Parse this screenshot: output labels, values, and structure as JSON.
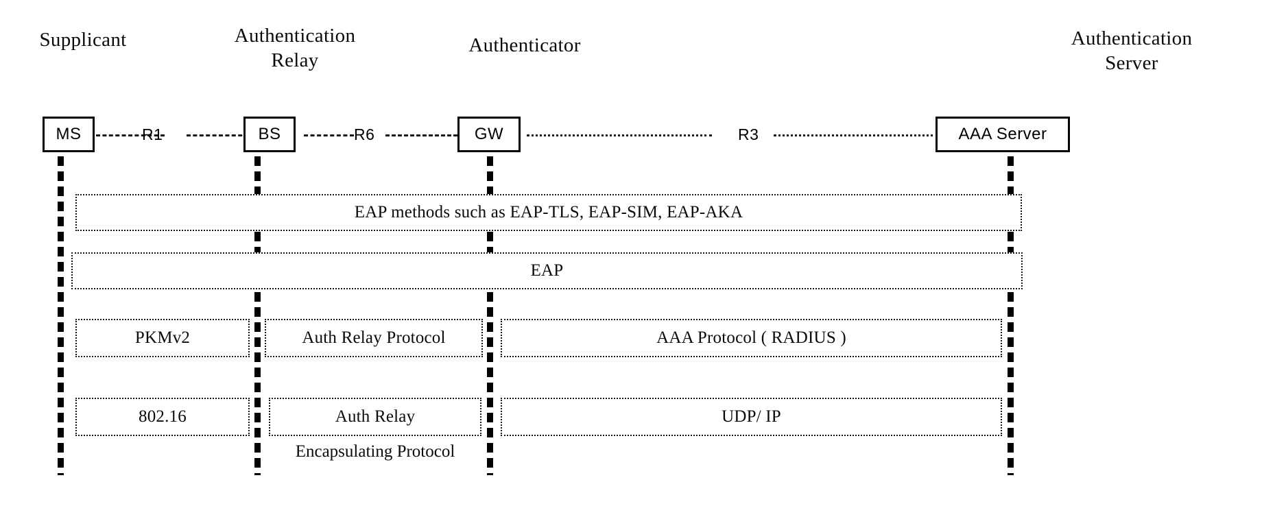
{
  "diagram": {
    "roles": [
      {
        "id": "supplicant",
        "label": "Supplicant"
      },
      {
        "id": "auth-relay",
        "label": "Authentication\nRelay"
      },
      {
        "id": "authenticator",
        "label": "Authenticator"
      },
      {
        "id": "auth-server",
        "label": "Authentication\nServer"
      }
    ],
    "nodes": [
      {
        "id": "ms",
        "label": "MS"
      },
      {
        "id": "bs",
        "label": "BS"
      },
      {
        "id": "gw",
        "label": "GW"
      },
      {
        "id": "aaa-server",
        "label": "AAA Server"
      }
    ],
    "reference_points": [
      {
        "id": "r1",
        "label": "R1"
      },
      {
        "id": "r6",
        "label": "R6"
      },
      {
        "id": "r3",
        "label": "R3"
      }
    ],
    "layers": [
      {
        "id": "eap-methods",
        "boxes": [
          {
            "id": "eap-methods-box",
            "label": "EAP methods such as EAP-TLS, EAP-SIM, EAP-AKA"
          }
        ]
      },
      {
        "id": "eap",
        "boxes": [
          {
            "id": "eap-box",
            "label": "EAP"
          }
        ]
      },
      {
        "id": "transport-protocol",
        "boxes": [
          {
            "id": "pkmv2-box",
            "label": "PKMv2"
          },
          {
            "id": "auth-relay-protocol-box",
            "label": "Auth Relay Protocol"
          },
          {
            "id": "aaa-protocol-box",
            "label": "AAA Protocol ( RADIUS )"
          }
        ]
      },
      {
        "id": "link-layer",
        "boxes": [
          {
            "id": "80216-box",
            "label": "802.16"
          },
          {
            "id": "auth-relay-box",
            "label": "Auth Relay"
          },
          {
            "id": "udpip-box",
            "label": "UDP/ IP"
          }
        ]
      }
    ],
    "captions": [
      {
        "id": "encapsulating-protocol",
        "label": "Encapsulating Protocol"
      }
    ],
    "colors": {
      "ink": "#000000",
      "background": "#ffffff"
    }
  }
}
